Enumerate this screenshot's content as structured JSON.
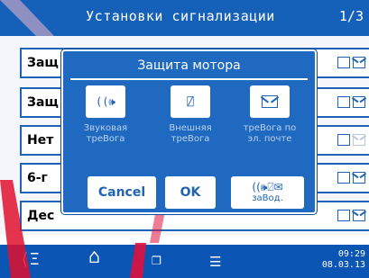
{
  "header": {
    "title": "Установки сигнализации",
    "page_indicator": "1/3"
  },
  "list": {
    "rows": [
      {
        "label": "Защ",
        "icons": [
          "ext-icon",
          "mail-icon"
        ],
        "mail_faded": false
      },
      {
        "label": "Защ",
        "icons": [
          "ext-icon",
          "mail-icon"
        ],
        "mail_faded": false
      },
      {
        "label": "Нет",
        "icons": [
          "ext-icon",
          "mail-icon"
        ],
        "mail_faded": true
      },
      {
        "label": "6-г",
        "icons": [
          "ext-icon",
          "mail-icon"
        ],
        "mail_faded": false
      },
      {
        "label": "Дес",
        "icons": [
          "ext-icon",
          "mail-icon"
        ],
        "mail_faded": false
      }
    ]
  },
  "dialog": {
    "title": "Защита мотора",
    "options": [
      {
        "icon": "sound-icon",
        "glyph": "((🕪",
        "caption_line1": "Звуковая",
        "caption_line2": "треВога"
      },
      {
        "icon": "external-alarm-icon",
        "glyph": "⍁",
        "caption_line1": "Внешняя",
        "caption_line2": "треВога"
      },
      {
        "icon": "email-icon",
        "glyph": "✉",
        "caption_line1": "треВога по",
        "caption_line2": "эл. почте"
      }
    ],
    "buttons": {
      "cancel": "Cancel",
      "ok": "OK",
      "default_label": "заВод.",
      "default_glyphs": "((🕪⍁✉"
    }
  },
  "navbar": {
    "back_glyph": "⟨Ξ",
    "home_glyph": "⌂",
    "recent_glyph": "❐",
    "menu_glyph": "☰",
    "time": "09:29",
    "date": "08.03.13"
  },
  "colors": {
    "header_blue": "#1560b8",
    "dialog_blue": "#1f6ac0",
    "navbar_blue": "#0b55b5",
    "caption_text": "#bcd2f0"
  }
}
